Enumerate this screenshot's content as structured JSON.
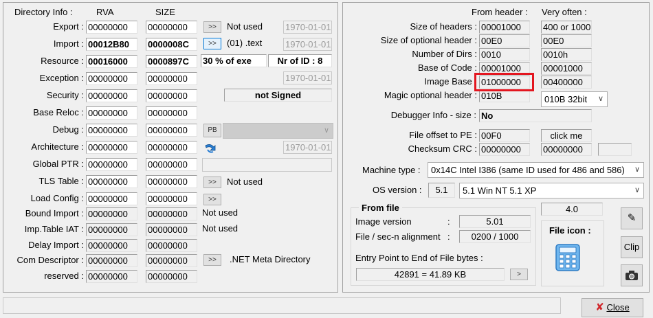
{
  "left": {
    "headers": {
      "title": "Directory Info :",
      "rva": "RVA",
      "size": "SIZE"
    },
    "rows": [
      {
        "label": "Export :",
        "rva": "00000000",
        "size": "00000000",
        "extra": "Not used",
        "date": "1970-01-01"
      },
      {
        "label": "Import :",
        "rva": "00012B80",
        "size": "0000008C",
        "extra": "(01) .text",
        "date": "1970-01-01"
      },
      {
        "label": "Resource :",
        "rva": "00016000",
        "size": "0000897C",
        "percent": "30  % of exe",
        "nrid": "Nr of ID : 8"
      },
      {
        "label": "Exception :",
        "rva": "00000000",
        "size": "00000000",
        "date": "1970-01-01"
      },
      {
        "label": "Security :",
        "rva": "00000000",
        "size": "00000000",
        "signed": "not Signed"
      },
      {
        "label": "Base Reloc :",
        "rva": "00000000",
        "size": "00000000"
      },
      {
        "label": "Debug :",
        "rva": "00000000",
        "size": "00000000",
        "pb": "PB"
      },
      {
        "label": "Architecture :",
        "rva": "00000000",
        "size": "00000000",
        "date": "1970-01-01"
      },
      {
        "label": "Global PTR :",
        "rva": "00000000",
        "size": "00000000"
      },
      {
        "label": "TLS Table :",
        "rva": "00000000",
        "size": "00000000",
        "extra": "Not used"
      },
      {
        "label": "Load Config :",
        "rva": "00000000",
        "size": "00000000"
      },
      {
        "label": "Bound Import :",
        "rva": "00000000",
        "size": "00000000",
        "extra": "Not used"
      },
      {
        "label": "Imp.Table IAT :",
        "rva": "00000000",
        "size": "00000000",
        "extra": "Not used"
      },
      {
        "label": "Delay Import :",
        "rva": "00000000",
        "size": "00000000"
      },
      {
        "label": "Com Descriptor :",
        "rva": "00000000",
        "size": "00000000",
        "extra": ".NET Meta Directory"
      },
      {
        "label": "reserved :",
        "rva": "00000000",
        "size": "00000000"
      }
    ],
    "arrow_label": ">>"
  },
  "right": {
    "headers": {
      "from_header": "From header :",
      "very_often": "Very often :"
    },
    "rows": [
      {
        "label": "Size of headers :",
        "value": "00001000",
        "often": "400 or 1000"
      },
      {
        "label": "Size of optional header :",
        "value": "00E0",
        "often": "00E0"
      },
      {
        "label": "Number of Dirs :",
        "value": "0010",
        "often": "0010h"
      },
      {
        "label": "Base of Code :",
        "value": "00001000",
        "often": "00001000"
      },
      {
        "label": "Image Base :",
        "value": "01000000",
        "often": "00400000"
      },
      {
        "label": "Magic optional header :",
        "value": "010B",
        "often": "010B 32bit"
      }
    ],
    "debugger": {
      "label": "Debugger Info  -  size :",
      "value": "No"
    },
    "file_offset": {
      "label": "File offset to PE :",
      "value": "00F0",
      "button": "click me"
    },
    "checksum": {
      "label": "Checksum CRC :",
      "value": "00000000",
      "often": "00000000"
    },
    "machine": {
      "label": "Machine type :",
      "value": "0x14C   Intel I386 (same ID used for 486 and 586)"
    },
    "os": {
      "label": "OS version :",
      "value": "5.1",
      "select": "5.1   Win NT 5.1 XP"
    },
    "from_file": {
      "title": "From file",
      "image_version": {
        "label": "Image version",
        "colon": ":",
        "value": "5.01"
      },
      "alignment": {
        "label": "File / sec-n alignment",
        "colon": ":",
        "value": "0200   /   1000"
      },
      "entry": {
        "label": "Entry Point to End of File bytes :",
        "value": "42891  =  41.89 KB",
        "button": ">"
      }
    },
    "version_value": "4.0",
    "file_icon_label": "File icon :",
    "clip_button": "Clip"
  },
  "footer": {
    "close_button": "Close"
  },
  "colors": {
    "highlight": "#e3161f",
    "focus": "#0078d7"
  }
}
